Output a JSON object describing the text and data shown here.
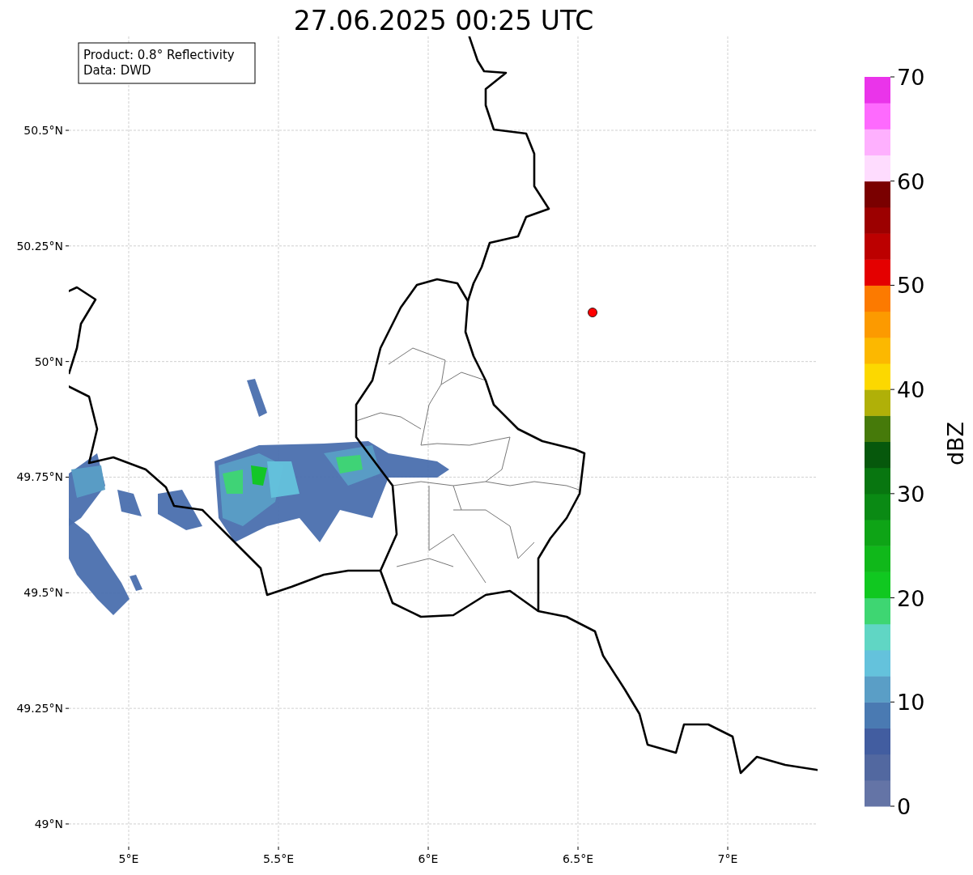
{
  "title": "27.06.2025 00:25 UTC",
  "info_box": [
    "Product: 0.8° Reflectivity",
    "Data: DWD"
  ],
  "map": {
    "y_ticks": [
      "50.5°N",
      "50.25°N",
      "50°N",
      "49.75°N",
      "49.5°N",
      "49.25°N",
      "49°N"
    ],
    "x_ticks": [
      "5°E",
      "5.5°E",
      "6°E",
      "6.5°E",
      "7°E"
    ]
  },
  "colorbar": {
    "label": "dBZ",
    "ticks": [
      "70",
      "60",
      "50",
      "40",
      "30",
      "20",
      "10",
      "0"
    ],
    "bins": [
      {
        "color": "#6474a6"
      },
      {
        "color": "#5268a0"
      },
      {
        "color": "#425da0"
      },
      {
        "color": "#4a7ab2"
      },
      {
        "color": "#5a9ec6"
      },
      {
        "color": "#64c2dc"
      },
      {
        "color": "#60d6c4"
      },
      {
        "color": "#3ed672"
      },
      {
        "color": "#10c820"
      },
      {
        "color": "#10b81a"
      },
      {
        "color": "#0ea416"
      },
      {
        "color": "#0a8a14"
      },
      {
        "color": "#087610"
      },
      {
        "color": "#06580c"
      },
      {
        "color": "#467a0a"
      },
      {
        "color": "#b0b008"
      },
      {
        "color": "#fcd800"
      },
      {
        "color": "#fcb800"
      },
      {
        "color": "#fc9a00"
      },
      {
        "color": "#fc7a00"
      },
      {
        "color": "#e40000"
      },
      {
        "color": "#bc0000"
      },
      {
        "color": "#9c0000"
      },
      {
        "color": "#7a0000"
      },
      {
        "color": "#fedcfe"
      },
      {
        "color": "#feb0fe"
      },
      {
        "color": "#fe6afe"
      },
      {
        "color": "#ea34ea"
      }
    ]
  }
}
